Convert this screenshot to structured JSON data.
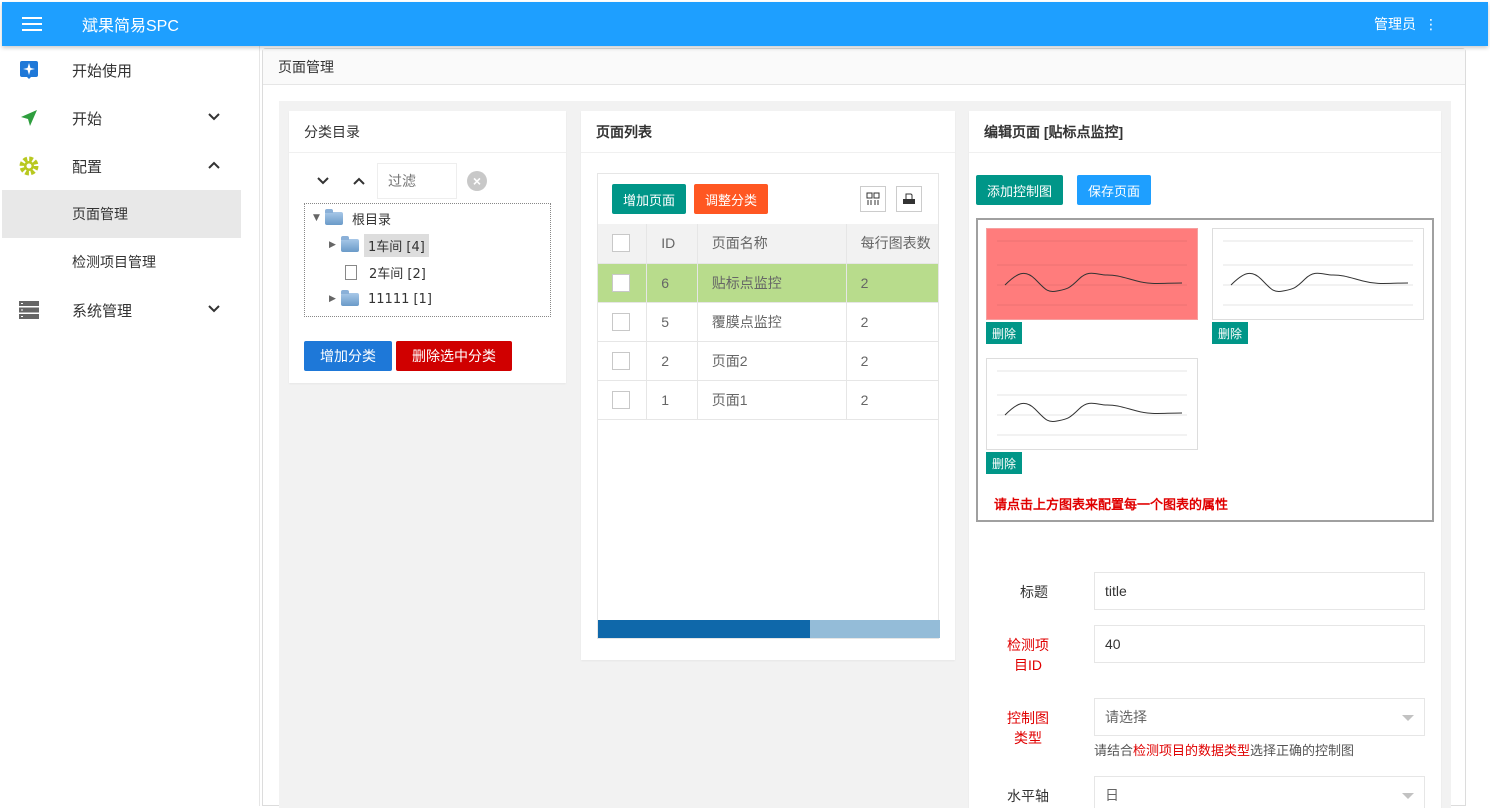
{
  "header": {
    "title": "斌果简易SPC",
    "user": "管理员",
    "more_icon": "⋮"
  },
  "sidebar": {
    "items": [
      {
        "label": "开始使用"
      },
      {
        "label": "开始"
      },
      {
        "label": "配置"
      },
      {
        "label": "页面管理"
      },
      {
        "label": "检测项目管理"
      },
      {
        "label": "系统管理"
      }
    ]
  },
  "page": {
    "breadcrumb": "页面管理"
  },
  "category": {
    "title": "分类目录",
    "filter_placeholder": "过滤",
    "tree": [
      {
        "label": "根目录"
      },
      {
        "label": "1车间 [4]"
      },
      {
        "label": "2车间 [2]"
      },
      {
        "label": "11111 [1]"
      }
    ],
    "add_label": "增加分类",
    "delete_label": "删除选中分类"
  },
  "pagelist": {
    "title": "页面列表",
    "add_label": "增加页面",
    "adjust_label": "调整分类",
    "columns": [
      "ID",
      "页面名称",
      "每行图表数"
    ],
    "rows": [
      {
        "id": "6",
        "name": "贴标点监控",
        "count": "2"
      },
      {
        "id": "5",
        "name": "覆膜点监控",
        "count": "2"
      },
      {
        "id": "2",
        "name": "页面2",
        "count": "2"
      },
      {
        "id": "1",
        "name": "页面1",
        "count": "2"
      }
    ]
  },
  "edit": {
    "title": "编辑页面 [贴标点监控]",
    "add_chart_label": "添加控制图",
    "save_label": "保存页面",
    "delete_label": "删除",
    "hint": "请点击上方图表来配置每一个图表的属性",
    "form": {
      "title_label": "标题",
      "title_value": "title",
      "item_label_1": "检测项",
      "item_label_2": "目ID",
      "item_value": "40",
      "type_label_1": "控制图",
      "type_label_2": "类型",
      "type_value": "请选择",
      "type_help_pre": "请结合",
      "type_help_red": "检测项目的数据类型",
      "type_help_post": "选择正确的控制图",
      "axis_label": "水平轴",
      "axis_value": "日"
    }
  },
  "colors": {
    "header": "#1e9fff",
    "teal": "#009688",
    "orange": "#ff5722",
    "red": "#d00000",
    "blue": "#1e78d8",
    "highlight": "#b8dc8c"
  }
}
